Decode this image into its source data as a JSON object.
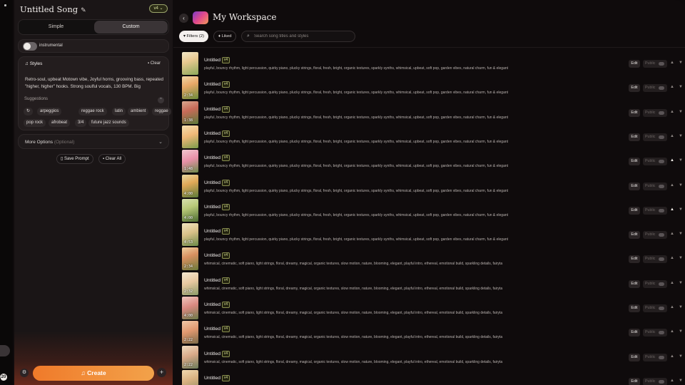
{
  "rail": {
    "badge": "20"
  },
  "panel": {
    "title": "Untitled Song",
    "model_chip": "v4 ⌄",
    "mode_tabs": [
      "Simple",
      "Custom"
    ],
    "active_mode": "Custom",
    "instrumental_label": "instrumental",
    "styles": {
      "header": "Styles",
      "clear": "Clear",
      "text": "Retro-soul, upbeat Motown vibe, Joyful horns, grooving bass, repeated \"higher, higher\" hooks. Strong soulful vocals, 130 BPM. Big",
      "suggestions_label": "Suggestions",
      "chips": [
        "arpeggios",
        "reggae rock",
        "latin",
        "ambient",
        "reggae",
        "pop rock",
        "afrobeat",
        "3/4",
        "future jazz sounds"
      ]
    },
    "more_options": "More Options",
    "more_options_hint": "(Optional)",
    "save_prompt": "Save Prompt",
    "clear_all": "Clear All",
    "create": "Create"
  },
  "workspace": {
    "title": "My Workspace",
    "filters": "Filters (2)",
    "liked": "Liked",
    "search_placeholder": "Search song titles and styles",
    "edit_label": "Edit",
    "public_label": "Public",
    "tracks": [
      {
        "title": "Untitled",
        "version": "v4",
        "duration": "",
        "liked": false,
        "tags": "playful, bouncy rhythm, light percussion, quirky piano, plucky strings, floral, fresh, bright, organic textures, sparkly synths, whimsical, upbeat, soft pop, garden vibes, natural charm, fun & elegant"
      },
      {
        "title": "Untitled",
        "version": "v4",
        "duration": "2:34",
        "liked": false,
        "tags": "playful, bouncy rhythm, light percussion, quirky piano, plucky strings, floral, fresh, bright, organic textures, sparkly synths, whimsical, upbeat, soft pop, garden vibes, natural charm, fun & elegant"
      },
      {
        "title": "Untitled",
        "version": "v4",
        "duration": "1:38",
        "liked": false,
        "tags": "playful, bouncy rhythm, light percussion, quirky piano, plucky strings, floral, fresh, bright, organic textures, sparkly synths, whimsical, upbeat, soft pop, garden vibes, natural charm, fun & elegant"
      },
      {
        "title": "Untitled",
        "version": "v4",
        "duration": "",
        "liked": false,
        "tags": "playful, bouncy rhythm, light percussion, quirky piano, plucky strings, floral, fresh, bright, organic textures, sparkly synths, whimsical, upbeat, soft pop, garden vibes, natural charm, fun & elegant"
      },
      {
        "title": "Untitled",
        "version": "v4",
        "duration": "1:48",
        "liked": true,
        "tags": "playful, bouncy rhythm, light percussion, quirky piano, plucky strings, floral, fresh, bright, organic textures, sparkly synths, whimsical, upbeat, soft pop, garden vibes, natural charm, fun & elegant"
      },
      {
        "title": "Untitled",
        "version": "v4",
        "duration": "4:00",
        "liked": false,
        "tags": "playful, bouncy rhythm, light percussion, quirky piano, plucky strings, floral, fresh, bright, organic textures, sparkly synths, whimsical, upbeat, soft pop, garden vibes, natural charm, fun & elegant"
      },
      {
        "title": "Untitled",
        "version": "v4",
        "duration": "4:00",
        "liked": true,
        "tags": "playful, bouncy rhythm, light percussion, quirky piano, plucky strings, floral, fresh, bright, organic textures, sparkly synths, whimsical, upbeat, soft pop, garden vibes, natural charm, fun & elegant"
      },
      {
        "title": "Untitled",
        "version": "v4",
        "duration": "4:53",
        "liked": false,
        "tags": "playful, bouncy rhythm, light percussion, quirky piano, plucky strings, floral, fresh, bright, organic textures, sparkly synths, whimsical, upbeat, soft pop, garden vibes, natural charm, fun & elegant"
      },
      {
        "title": "Untitled",
        "version": "v4",
        "duration": "2:34",
        "liked": false,
        "tags": "whimsical, cinematic, soft piano, light strings, floral, dreamy, magical, organic textures, slow motion, nature, blooming, elegant, playful intro, ethereal, emotional build, sparkling details, fairyta"
      },
      {
        "title": "Untitled",
        "version": "v4",
        "duration": "2:32",
        "liked": false,
        "tags": "whimsical, cinematic, soft piano, light strings, floral, dreamy, magical, organic textures, slow motion, nature, blooming, elegant, playful intro, ethereal, emotional build, sparkling details, fairyta"
      },
      {
        "title": "Untitled",
        "version": "v4",
        "duration": "4:00",
        "liked": false,
        "tags": "whimsical, cinematic, soft piano, light strings, floral, dreamy, magical, organic textures, slow motion, nature, blooming, elegant, playful intro, ethereal, emotional build, sparkling details, fairyta"
      },
      {
        "title": "Untitled",
        "version": "v4",
        "duration": "2:22",
        "liked": false,
        "tags": "whimsical, cinematic, soft piano, light strings, floral, dreamy, magical, organic textures, slow motion, nature, blooming, elegant, playful intro, ethereal, emotional build, sparkling details, fairyta"
      },
      {
        "title": "Untitled",
        "version": "v4",
        "duration": "2:22",
        "liked": false,
        "tags": "whimsical, cinematic, soft piano, light strings, floral, dreamy, magical, organic textures, slow motion, nature, blooming, elegant, playful intro, ethereal, emotional build, sparkling details, fairyta"
      },
      {
        "title": "Untitled",
        "version": "v4",
        "duration": "",
        "liked": false,
        "tags": ""
      }
    ]
  },
  "colors": {
    "accent": "#f2903a",
    "version_chip": "#9aa36a"
  }
}
